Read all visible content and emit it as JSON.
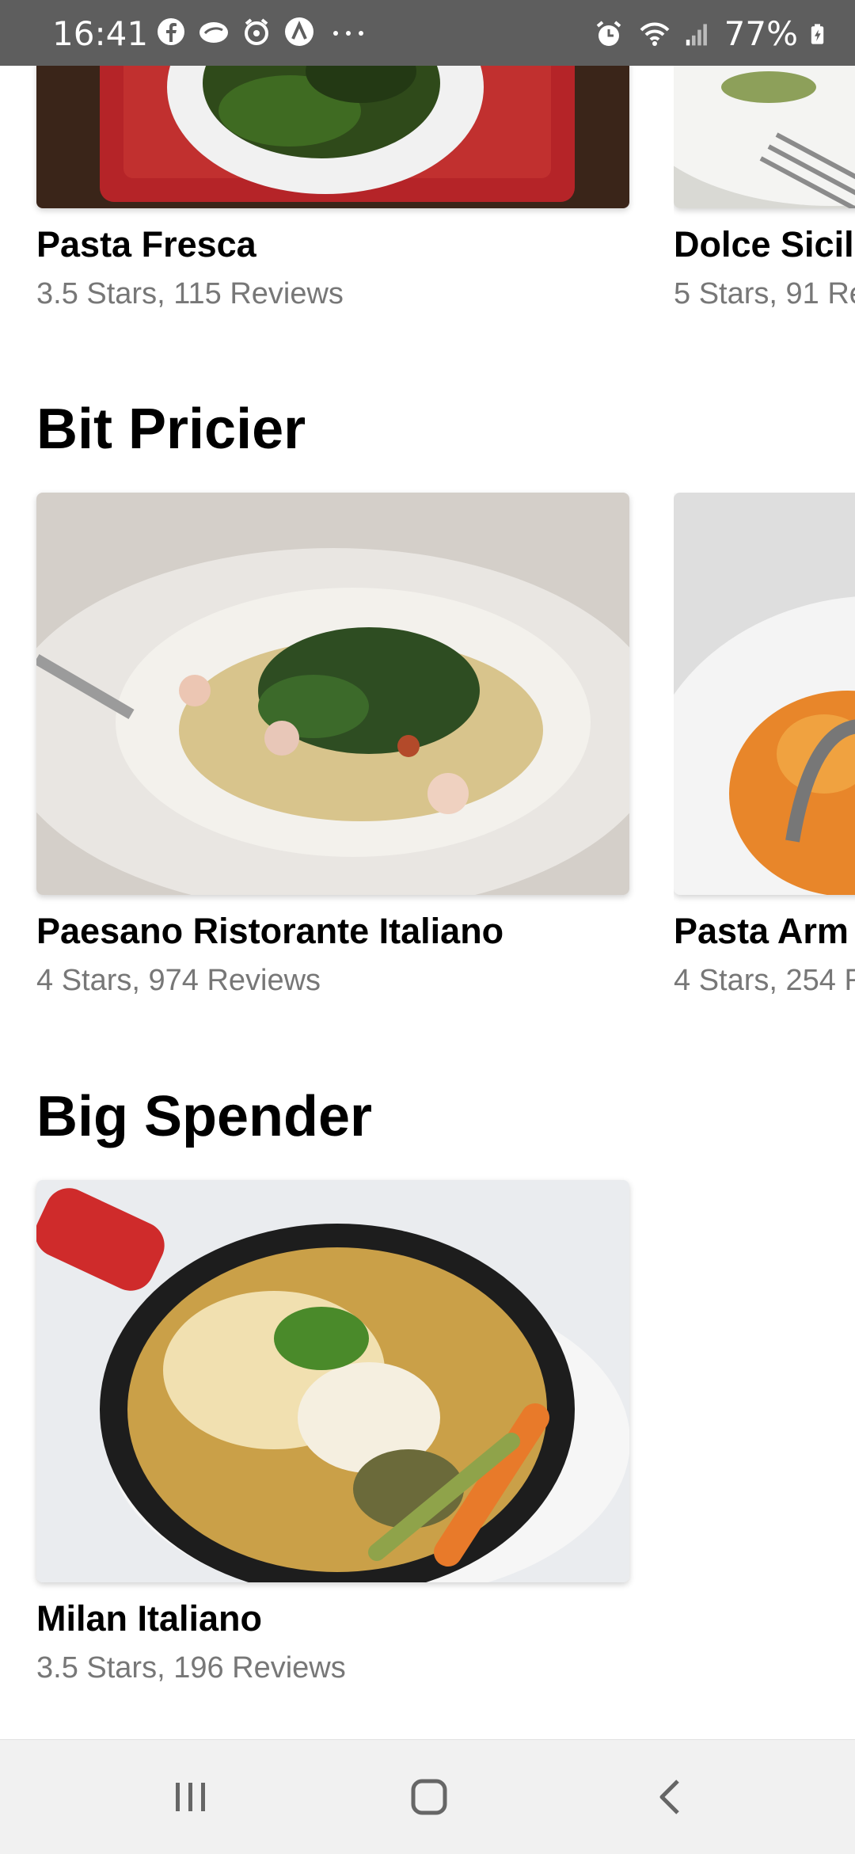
{
  "status_bar": {
    "time": "16:41",
    "battery": "77%",
    "left_icons": [
      "facebook-icon",
      "messenger-icon",
      "alarm-app-icon",
      "a-app-icon",
      "more-dots-icon"
    ],
    "right_icons": [
      "alarm-icon",
      "wifi-icon",
      "signal-icon",
      "battery-icon"
    ]
  },
  "top_row": {
    "items": [
      {
        "name": "Pasta Fresca",
        "meta": "3.5 Stars, 115 Reviews"
      },
      {
        "name": "Dolce Sicil",
        "meta": "5 Stars, 91 Re"
      }
    ]
  },
  "sections": [
    {
      "title": "Bit Pricier",
      "items": [
        {
          "name": "Paesano Ristorante Italiano",
          "meta": "4 Stars, 974 Reviews"
        },
        {
          "name": "Pasta Arm",
          "meta": "4 Stars, 254 R"
        }
      ]
    },
    {
      "title": "Big Spender",
      "items": [
        {
          "name": "Milan Italiano",
          "meta": "3.5 Stars, 196 Reviews"
        }
      ]
    }
  ],
  "nav": {
    "icons": [
      "recent-apps-icon",
      "home-icon",
      "back-icon"
    ]
  },
  "colors": {
    "status_bar_bg": "#5e5e5e",
    "meta_text": "#777777",
    "nav_bg": "#f1f1f1"
  }
}
